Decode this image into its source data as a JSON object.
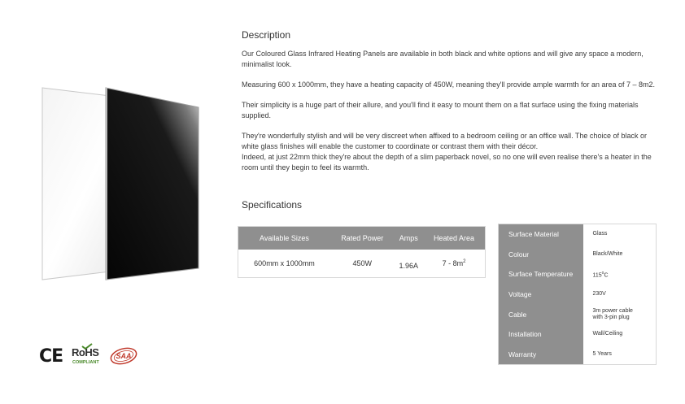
{
  "description": {
    "title": "Description",
    "paragraphs": [
      "Our Coloured Glass Infrared Heating Panels are available in both black and white options and will give any space a modern, minimalist look.",
      "Measuring 600 x 1000mm, they have a heating capacity of 450W, meaning they'll provide ample warmth for an area of 7 – 8m2.",
      "Their simplicity is a huge part of their allure, and you'll find it easy to mount them on a flat surface using the fixing materials supplied.",
      "They're wonderfully stylish and will be very discreet when affixed to a bedroom ceiling or an office wall. The choice of black or white glass finishes will enable the customer to coordinate or contrast them with their décor.",
      "Indeed, at just 22mm thick they're about the depth of a slim paperback novel, so no one will even realise there's a heater in the room until they begin to feel its warmth."
    ]
  },
  "specifications": {
    "title": "Specifications",
    "headers": [
      "Available Sizes",
      "Rated Power",
      "Amps",
      "Heated Area"
    ],
    "row": {
      "size": "600mm x 1000mm",
      "power": "450W",
      "amps": "1.96A",
      "area": "7 - 8m",
      "area_sup": "2"
    }
  },
  "details": [
    {
      "key": "Surface Material",
      "value": "Glass"
    },
    {
      "key": "Colour",
      "value": "Black/White"
    },
    {
      "key": "Surface Temperature",
      "value": "115",
      "sup": "o",
      "suffix": "C"
    },
    {
      "key": "Voltage",
      "value": "230V"
    },
    {
      "key": "Cable",
      "value": "3m  power cable",
      "value2": "with 3-pin plug"
    },
    {
      "key": "Installation",
      "value": "Wall/Ceiling"
    },
    {
      "key": "Warranty",
      "value": "5 Years"
    }
  ],
  "logos": {
    "ce": "CE",
    "rohs": "RoHS",
    "rohs_sub": "COMPLIANT",
    "saa": "SAA"
  },
  "colors": {
    "header_gray": "#8f8f8f",
    "text": "#333333",
    "rohs_green": "#4a8a2a",
    "saa_red": "#c0392b"
  }
}
